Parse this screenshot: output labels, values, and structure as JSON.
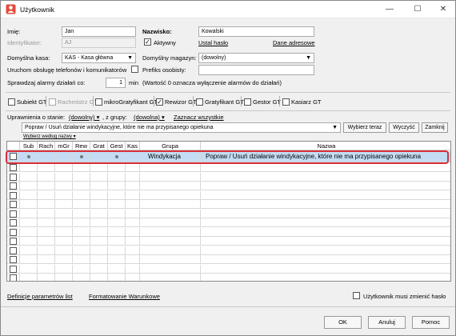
{
  "window": {
    "title": "Użytkownik",
    "minimize": "—",
    "maximize": "☐",
    "close": "✕"
  },
  "form": {
    "imie_label": "Imię:",
    "imie_value": "Jan",
    "nazwisko_label": "Nazwisko:",
    "nazwisko_value": "Kowalski",
    "identyfikator_label": "Identyfikator:",
    "identyfikator_value": "AJ",
    "aktywny_label": "Aktywny",
    "aktywny_checked": true,
    "ustal_haslo": "Ustal hasło",
    "dane_adresowe": "Dane adresowe",
    "kasa_label": "Domyślna kasa:",
    "kasa_value": "KAS - Kasa główna",
    "magazyn_label": "Domyślny magazyn:",
    "magazyn_value": "(dowolny)",
    "telefony_label": "Uruchom obsługę telefonów i komunikatorów",
    "prefiks_label": "Prefiks osobisty:",
    "prefiks_value": "",
    "alarmy_label": "Sprawdzaj alarmy działań co:",
    "alarmy_value": "1",
    "alarmy_unit": "min",
    "alarmy_note": "(Wartość 0 oznacza wyłączenie alarmów do działań)"
  },
  "roles": [
    {
      "label": "Subiekt GT",
      "checked": false,
      "disabled": false
    },
    {
      "label": "Rachmistrz GT",
      "checked": false,
      "disabled": true
    },
    {
      "label": "mikroGratyfikant GT",
      "checked": false,
      "disabled": false
    },
    {
      "label": "Rewizor GT",
      "checked": true,
      "disabled": false
    },
    {
      "label": "Gratyfikant GT",
      "checked": false,
      "disabled": false
    },
    {
      "label": "Gestor GT",
      "checked": false,
      "disabled": false
    },
    {
      "label": "Kasiarz GT",
      "checked": false,
      "disabled": false
    }
  ],
  "filters": {
    "stan_label": "Uprawnienia o stanie:",
    "stan_value": "(dowolny)",
    "grupa_label": ", z grupy:",
    "grupa_value": "(dowolna)",
    "zaznacz": "Zaznacz wszystkie",
    "search_value": "Popraw / Usuń działanie windykacyjne, które nie ma przypisanego opiekuna",
    "btn_wybierz": "Wybierz teraz",
    "btn_wyczysc": "Wyczyść",
    "btn_zamknij": "Zamknij",
    "search_hint": "Wybierz według nazwy"
  },
  "grid": {
    "columns": [
      "",
      "Sub",
      "Rach",
      "mGr",
      "Rew",
      "Grat",
      "Gest",
      "Kas",
      "Grupa",
      "Nazwa"
    ],
    "selected_row": {
      "grupa": "Windykacja",
      "nazwa": "Popraw / Usuń działanie windykacyjne, które nie ma przypisanego opiekuna"
    },
    "empty_rows": 13
  },
  "footer": {
    "definicje": "Definicje parametrów list",
    "formatowanie": "Formatowanie Warunkowe",
    "musi_zmienic": "Użytkownik musi zmienić hasło",
    "ok": "OK",
    "anuluj": "Anuluj",
    "pomoc": "Pomoc"
  },
  "colors": {
    "selection": "#c3dcf3",
    "highlight_border": "#d9303a"
  }
}
